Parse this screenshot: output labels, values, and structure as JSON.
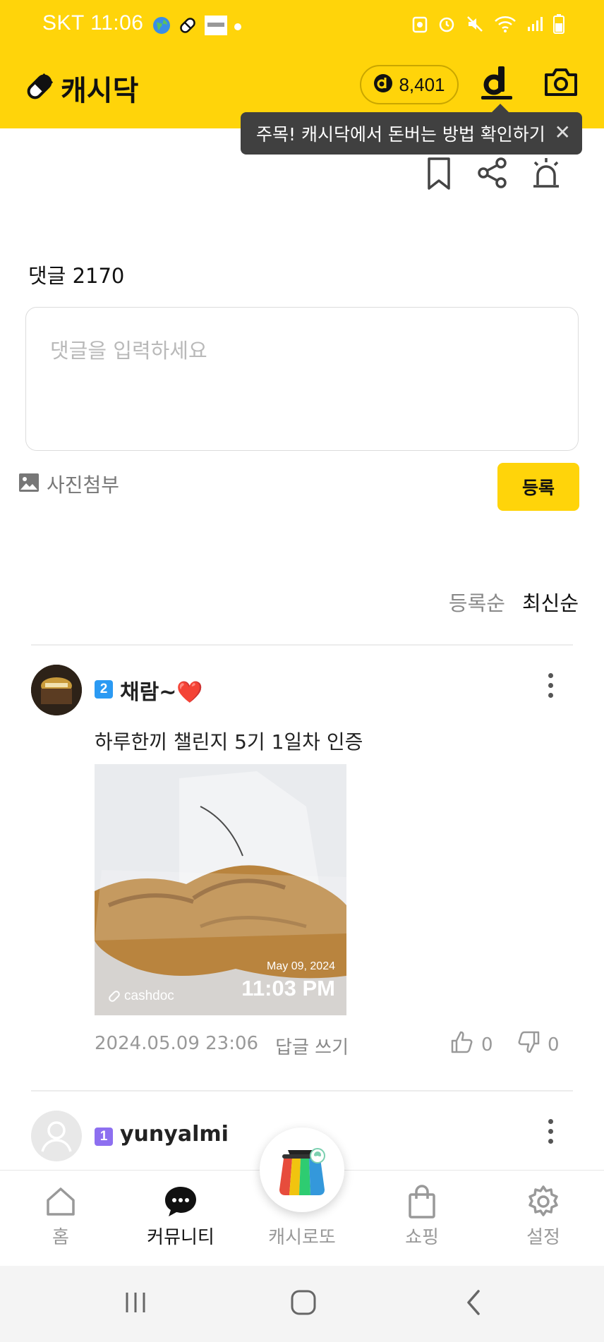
{
  "status_bar": {
    "carrier_time": "SKT 11:06"
  },
  "app": {
    "logo_text": "캐시닥",
    "points": "8,401"
  },
  "tooltip": {
    "text": "주목! 캐시닥에서 돈버는 방법 확인하기",
    "close": "✕"
  },
  "comments": {
    "count_label": "댓글 2170",
    "input_placeholder": "댓글을 입력하세요",
    "attach_label": "사진첨부",
    "submit_label": "등록",
    "sort": {
      "oldest": "등록순",
      "newest": "최신순"
    },
    "items": [
      {
        "level": "2",
        "nickname": "채람~❤️",
        "text": "하루한끼 챌린지 5기 1일차 인증",
        "photo": {
          "date": "May 09, 2024",
          "time": "11:03 PM",
          "brand": "cashdoc"
        },
        "timestamp": "2024.05.09 23:06",
        "reply_label": "답글 쓰기",
        "likes": "0",
        "dislikes": "0"
      },
      {
        "level": "1",
        "nickname": "yunyalmi"
      }
    ]
  },
  "bottom_nav": {
    "items": [
      {
        "label": "홈",
        "icon": "home-icon"
      },
      {
        "label": "커뮤니티",
        "icon": "chat-icon"
      },
      {
        "label": "캐시로또",
        "icon": "lotto-icon"
      },
      {
        "label": "쇼핑",
        "icon": "shopping-bag-icon"
      },
      {
        "label": "설정",
        "icon": "gear-icon"
      }
    ]
  },
  "colors": {
    "brand": "#FFD40A",
    "tooltip_bg": "#404040"
  }
}
